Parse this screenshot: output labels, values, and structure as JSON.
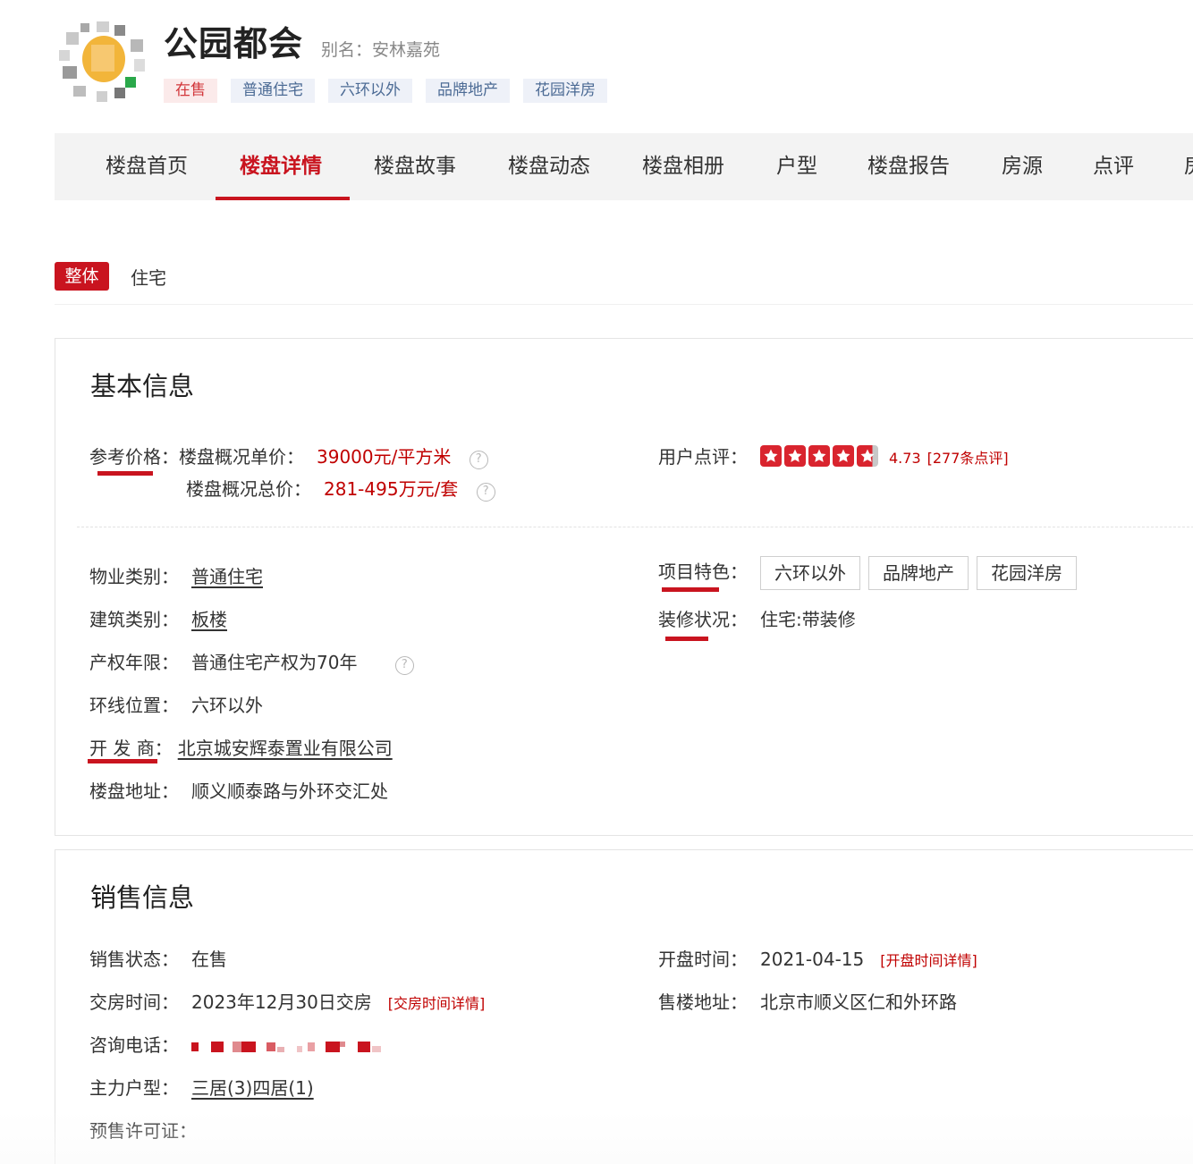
{
  "header": {
    "title": "公园都会",
    "alias": "别名：安林嘉苑",
    "tags": [
      "在售",
      "普通住宅",
      "六环以外",
      "品牌地产",
      "花园洋房"
    ]
  },
  "nav": {
    "items": [
      "楼盘首页",
      "楼盘详情",
      "楼盘故事",
      "楼盘动态",
      "楼盘相册",
      "户型",
      "楼盘报告",
      "房源",
      "点评",
      "房"
    ],
    "active_index": 1
  },
  "type_tabs": {
    "badge": "整体",
    "label": "住宅"
  },
  "basic_info": {
    "title": "基本信息",
    "price_label": "参考价格：",
    "unit_price_label": "楼盘概况单价：",
    "unit_price_value": "39000元/平方米",
    "total_price_label": "楼盘概况总价：",
    "total_price_value": "281-495万元/套",
    "rating_label": "用户点评：",
    "rating_value": "4.73",
    "rating_count": "[277条点评]",
    "rating_stars": 4.73,
    "property_type_label": "物业类别：",
    "property_type_value": "普通住宅",
    "building_type_label": "建筑类别：",
    "building_type_value": "板楼",
    "term_label": "产权年限：",
    "term_value": "普通住宅产权为70年",
    "ring_label": "环线位置：",
    "ring_value": "六环以外",
    "developer_label": "开 发 商：",
    "developer_value": "北京城安辉泰置业有限公司",
    "address_label": "楼盘地址：",
    "address_value": "顺义顺泰路与外环交汇处",
    "features_label": "项目特色：",
    "features": [
      "六环以外",
      "品牌地产",
      "花园洋房"
    ],
    "decoration_label": "装修状况：",
    "decoration_value": "住宅:带装修"
  },
  "sale_info": {
    "title": "销售信息",
    "status_label": "销售状态：",
    "status_value": "在售",
    "delivery_label": "交房时间：",
    "delivery_value": "2023年12月30日交房",
    "delivery_link": "[交房时间详情]",
    "phone_label": "咨询电话：",
    "main_type_label": "主力户型：",
    "main_type_value": "三居(3)四居(1)",
    "presale_label": "预售许可证：",
    "open_label": "开盘时间：",
    "open_value": "2021-04-15",
    "open_link": "[开盘时间详情]",
    "sales_address_label": "售楼地址：",
    "sales_address_value": "北京市顺义区仁和外环路"
  },
  "colors": {
    "brand_red": "#c9141f",
    "price_red": "#c00000",
    "tag_blue": "#4c6b95",
    "tag_bg": "#eef1f8"
  },
  "icons": {
    "help": "question-circle-icon",
    "star": "star-icon"
  }
}
